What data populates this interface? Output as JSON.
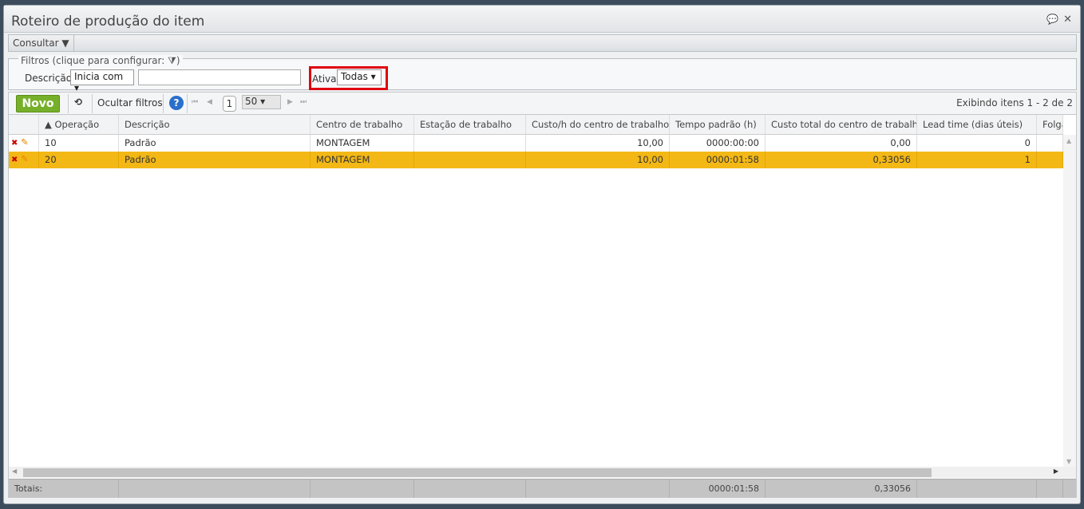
{
  "window": {
    "title": "Roteiro de produção do item",
    "chat_icon": "💬",
    "close_icon": "✕"
  },
  "menu": {
    "consultar": "Consultar ▼"
  },
  "filters": {
    "legend": "Filtros (clique para configurar:",
    "legend_icon": "⧩",
    "legend_end": ")",
    "descricao_label": "Descrição",
    "descricao_op": "Inicia com ▾",
    "descricao_value": "",
    "ativa_label": "Ativa",
    "ativa_value": "Todas ▾"
  },
  "toolbar": {
    "novo": "Novo",
    "refresh_icon": "⟲",
    "ocultar": "Ocultar filtros",
    "help": "?",
    "first": "⏮",
    "prev": "◀",
    "page": "1",
    "page_size": "50 ▾",
    "next": "▶",
    "last": "⏭",
    "status": "Exibindo itens 1 - 2 de 2"
  },
  "grid": {
    "headers": [
      "",
      "▲ Operação",
      "Descrição",
      "Centro de trabalho",
      "Estação de trabalho",
      "Custo/h do centro de trabalho",
      "Tempo padrão (h)",
      "Custo total do centro de trabalho",
      "Lead time (dias úteis)",
      "Folga"
    ],
    "rows": [
      {
        "op": "10",
        "desc": "Padrão",
        "centro": "MONTAGEM",
        "estacao": "",
        "custo_h": "10,00",
        "tempo": "0000:00:00",
        "custo_total": "0,00",
        "lead": "0",
        "folga": ""
      },
      {
        "op": "20",
        "desc": "Padrão",
        "centro": "MONTAGEM",
        "estacao": "",
        "custo_h": "10,00",
        "tempo": "0000:01:58",
        "custo_total": "0,33056",
        "lead": "1",
        "folga": "",
        "selected": true
      }
    ],
    "totals": {
      "label": "Totais:",
      "tempo": "0000:01:58",
      "custo_total": "0,33056"
    }
  },
  "colors": {
    "selected_row": "#f3b816",
    "novo": "#76b02a",
    "highlight": "#e00010"
  }
}
